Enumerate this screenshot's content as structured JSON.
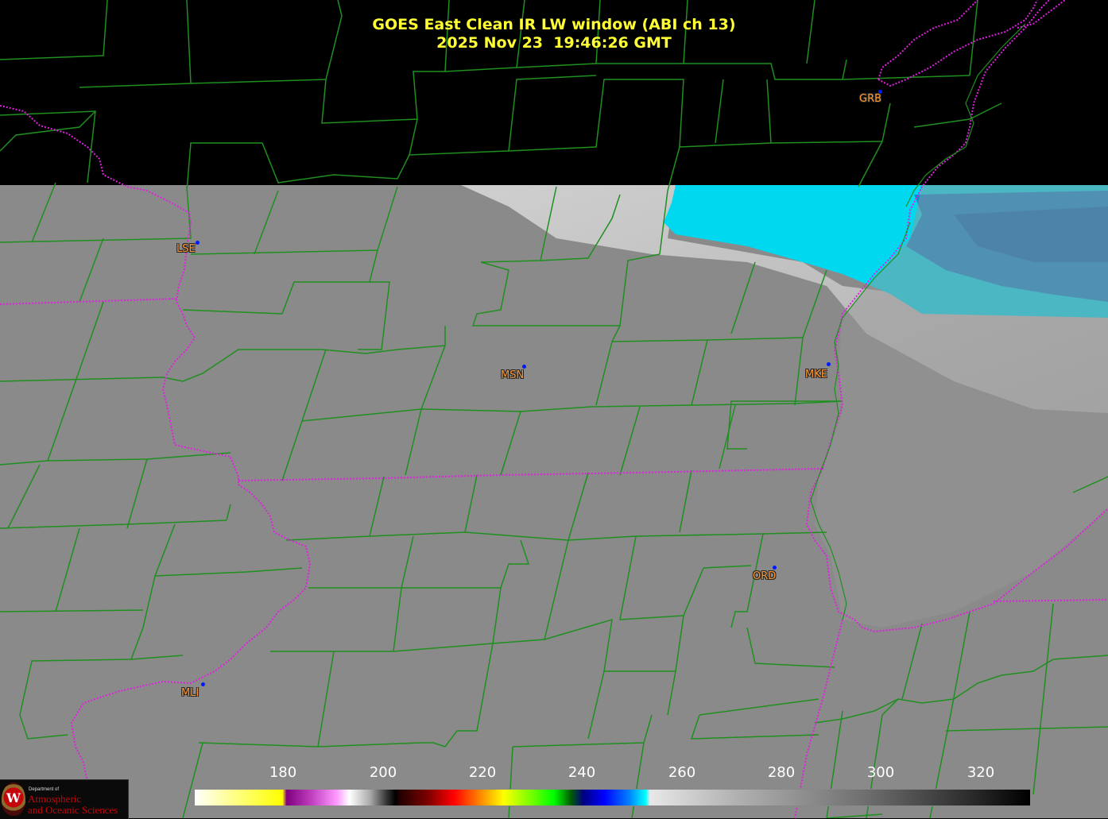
{
  "title": {
    "line1": "GOES East Clean IR LW window (ABI ch 13)",
    "line2": "2025 Nov 23  19:46:26 GMT"
  },
  "stations": [
    {
      "code": "GRB"
    },
    {
      "code": "LSE"
    },
    {
      "code": "MSN"
    },
    {
      "code": "MKE"
    },
    {
      "code": "ORD"
    },
    {
      "code": "MLI"
    }
  ],
  "colorbar": {
    "ticks": [
      "180",
      "200",
      "220",
      "240",
      "260",
      "280",
      "300",
      "320"
    ],
    "range": [
      163,
      330
    ],
    "colors": {
      "cold_cloud": "#00e5ff",
      "coldest_cloud": "#0080d0",
      "mid_cloud": "#d8d8d8",
      "ground": "#8a8a8a",
      "county_lines": "#1f8f1f",
      "state_lines": "#e020e0",
      "station_dot": "#0018ff",
      "station_label": "#ff9933",
      "title": "#ffff33"
    }
  },
  "logo": {
    "small": "Department of",
    "line1": "Atmospheric",
    "line2": "and Oceanic Sciences"
  }
}
